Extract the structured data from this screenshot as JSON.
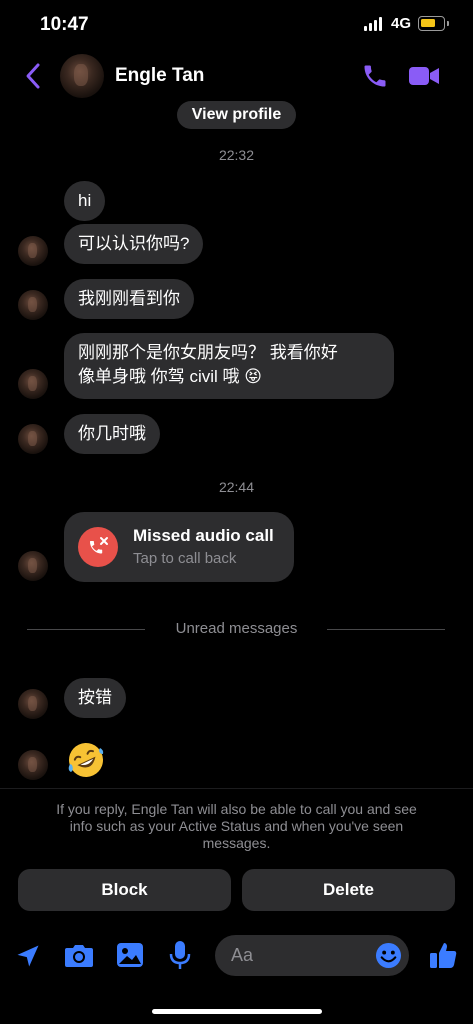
{
  "status_bar": {
    "time": "10:47",
    "network": "4G",
    "battery_level": 0.72
  },
  "header": {
    "name": "Engle Tan"
  },
  "view_profile": "View profile",
  "timestamps": [
    "22:32",
    "22:44"
  ],
  "messages": [
    {
      "text": "hi"
    },
    {
      "text": "可以认识你吗?"
    },
    {
      "text": "我刚刚看到你"
    },
    {
      "text": "刚刚那个是你女朋友吗？ 我看你好",
      "text2": "像单身哦 你驾 civil 哦 😝"
    },
    {
      "text": "你几时哦"
    }
  ],
  "missed_call": {
    "title": "Missed audio call",
    "subtitle": "Tap to call back"
  },
  "unread_label": "Unread messages",
  "unread_messages": [
    {
      "text": "按错"
    }
  ],
  "notice": {
    "line1": "If you reply, Engle Tan will also be able to call you and see",
    "line2": "info such as your Active Status and when you've seen",
    "line3": "messages."
  },
  "actions": {
    "block": "Block",
    "delete": "Delete"
  },
  "composer": {
    "placeholder": "Aa"
  },
  "colors": {
    "accent": "#8a5cf6",
    "toolbar_blue": "#3b7cff",
    "bubble": "#2d2d2f",
    "missed_call": "#e8514a"
  },
  "icons": [
    "back-chevron-icon",
    "phone-icon",
    "video-camera-icon",
    "missed-call-icon",
    "location-arrow-icon",
    "camera-icon",
    "image-icon",
    "microphone-icon",
    "emoji-icon",
    "thumbs-up-icon"
  ]
}
